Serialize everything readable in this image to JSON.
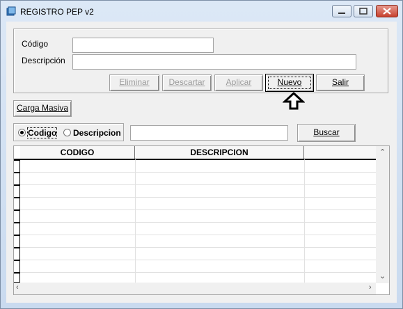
{
  "window": {
    "title": "REGISTRO PEP v2"
  },
  "form": {
    "codigo_label": "Código",
    "descripcion_label": "Descripción",
    "codigo_value": "",
    "descripcion_value": ""
  },
  "buttons": {
    "eliminar": "Eliminar",
    "descartar": "Descartar",
    "aplicar": "Aplicar",
    "nuevo": "Nuevo",
    "salir": "Salir",
    "carga_masiva": "Carga Masiva",
    "buscar": "Buscar"
  },
  "search": {
    "options": [
      "Codigo",
      "Descripcion"
    ],
    "selected": "Codigo",
    "value": ""
  },
  "grid": {
    "columns": [
      "CODIGO",
      "DESCRIPCION",
      ""
    ]
  },
  "colors": {
    "accent_close": "#c7412e",
    "window_bg": "#f0f0f0"
  }
}
